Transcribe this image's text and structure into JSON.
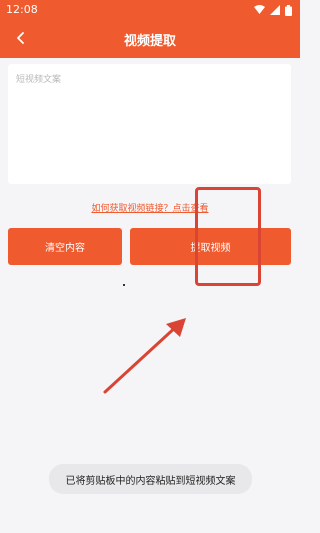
{
  "status_bar": {
    "time": "12:08",
    "icons": [
      "wifi-icon",
      "signal-icon",
      "battery-icon"
    ]
  },
  "app_bar": {
    "title": "视频提取",
    "back_icon": "chevron-left-icon"
  },
  "input": {
    "placeholder": "短视频文案",
    "value": ""
  },
  "help_link": "如何获取视频链接？点击查看",
  "buttons": {
    "clear": "清空内容",
    "extract": "提取视频"
  },
  "toast": "已将剪贴板中的内容粘贴到短视频文案",
  "colors": {
    "primary": "#ef5a2e",
    "annotation": "#d94434",
    "background": "#f5f5f7"
  }
}
